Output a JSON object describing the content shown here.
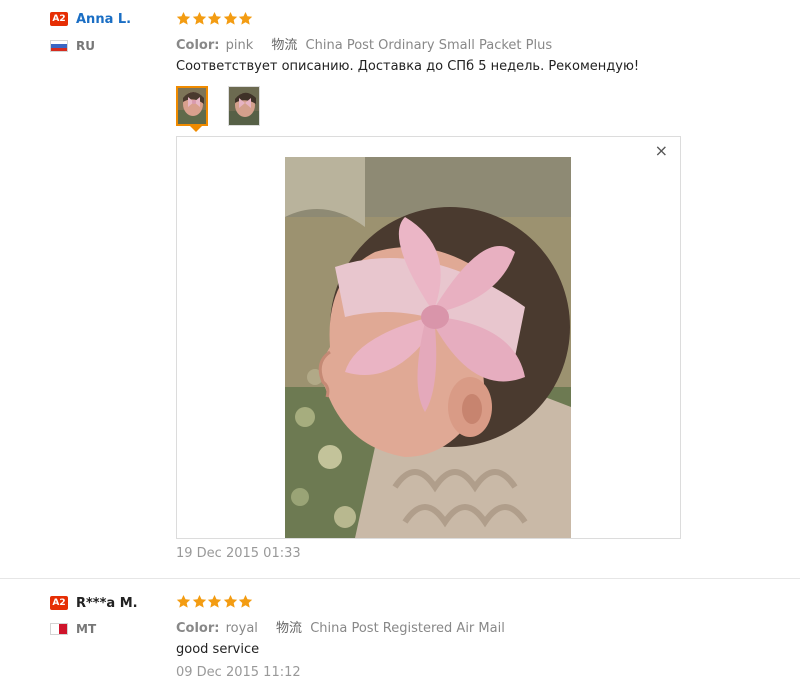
{
  "colors": {
    "badge": "#e62e04",
    "star": "#f39c12",
    "link": "#1a6ec4",
    "thumb_active_border": "#f08b00"
  },
  "reviews": [
    {
      "level": "A2",
      "name": "Anna L.",
      "country": "RU",
      "rating": 5,
      "color_label": "Color:",
      "color_value": "pink",
      "shipping_logo": "物流",
      "shipping_method": "China Post Ordinary Small Packet Plus",
      "text": "Соответствует описанию. Доставка до СПб 5 недель. Рекомендую!",
      "date": "19 Dec 2015 01:33",
      "close_glyph": "×"
    },
    {
      "level": "A2",
      "name": "R***a M.",
      "country": "MT",
      "rating": 5,
      "color_label": "Color:",
      "color_value": "royal",
      "shipping_logo": "物流",
      "shipping_method": "China Post Registered Air Mail",
      "text": "good service",
      "date": "09 Dec 2015 11:12"
    }
  ]
}
